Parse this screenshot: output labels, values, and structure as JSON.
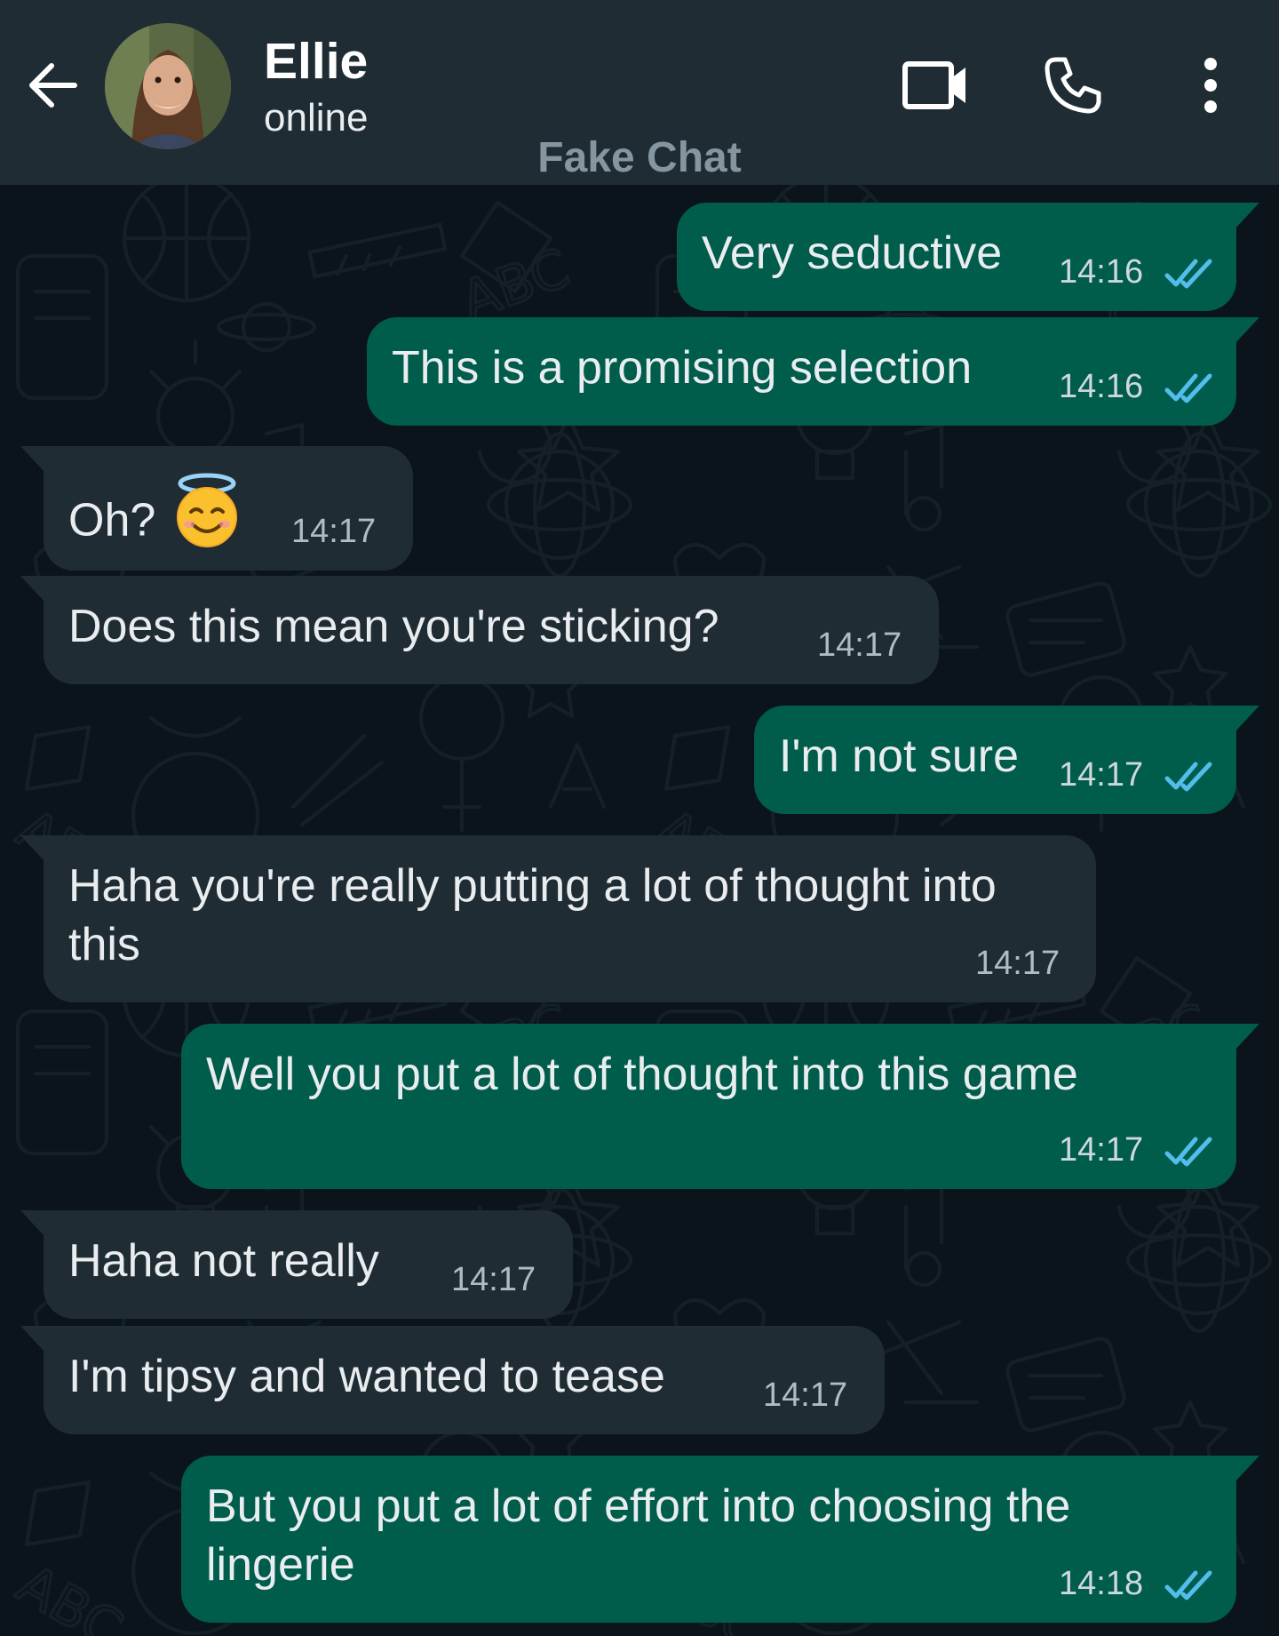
{
  "header": {
    "contact_name": "Ellie",
    "status": "online",
    "watermark": "Fake Chat",
    "icons": [
      "back-arrow-icon",
      "video-call-icon",
      "voice-call-icon",
      "more-options-icon"
    ]
  },
  "colors": {
    "header_bg": "#1f2c34",
    "chat_bg": "#0b141a",
    "outgoing_bubble": "#005c4b",
    "incoming_bubble": "#202c33",
    "read_ticks": "#53bdeb"
  },
  "messages": [
    {
      "direction": "out",
      "text": "Very seductive",
      "time": "14:16",
      "status": "read"
    },
    {
      "direction": "out",
      "text": "This is a promising selection",
      "time": "14:16",
      "status": "read"
    },
    {
      "direction": "in",
      "text": "Oh?",
      "emoji": "smiling-face-with-halo",
      "time": "14:17"
    },
    {
      "direction": "in",
      "text": "Does this mean you're sticking?",
      "time": "14:17"
    },
    {
      "direction": "out",
      "text": "I'm not sure",
      "time": "14:17",
      "status": "read"
    },
    {
      "direction": "in",
      "text_line1": "Haha you're really putting a lot of thought into",
      "text_line2": "this",
      "time": "14:17"
    },
    {
      "direction": "out",
      "text": "Well you put a lot of thought into this game",
      "time": "14:17",
      "status": "read"
    },
    {
      "direction": "in",
      "text": "Haha not really",
      "time": "14:17"
    },
    {
      "direction": "in",
      "text": "I'm tipsy and wanted to tease",
      "time": "14:17"
    },
    {
      "direction": "out",
      "text_line1": "But you put a lot of effort into choosing the",
      "text_line2": "lingerie",
      "time": "14:18",
      "status": "read"
    }
  ]
}
